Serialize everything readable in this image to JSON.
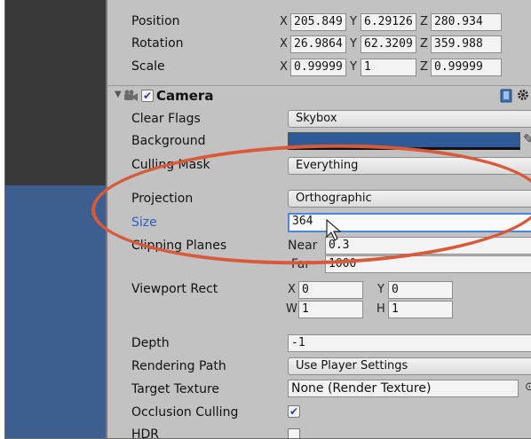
{
  "transform": {
    "position": {
      "label": "Position",
      "x_label": "X",
      "x": "205.849",
      "y_label": "Y",
      "y": "6.29126",
      "z_label": "Z",
      "z": "280.934"
    },
    "rotation": {
      "label": "Rotation",
      "x_label": "X",
      "x": "26.9864",
      "y_label": "Y",
      "y": "62.3209",
      "z_label": "Z",
      "z": "359.988"
    },
    "scale": {
      "label": "Scale",
      "x_label": "X",
      "x": "0.99999",
      "y_label": "Y",
      "y": "1",
      "z_label": "Z",
      "z": "0.99999"
    }
  },
  "camera": {
    "title": "Camera",
    "enabled_check": "✔",
    "clear_flags": {
      "label": "Clear Flags",
      "value": "Skybox"
    },
    "background": {
      "label": "Background",
      "color": "#2e5b96"
    },
    "culling_mask": {
      "label": "Culling Mask",
      "value": "Everything"
    },
    "projection": {
      "label": "Projection",
      "value": "Orthographic"
    },
    "size": {
      "label": "Size",
      "value": "364"
    },
    "clipping_planes": {
      "label": "Clipping Planes",
      "near_label": "Near",
      "near": "0.3",
      "far_label": "Far",
      "far": "1000"
    },
    "viewport_rect": {
      "label": "Viewport Rect",
      "x_label": "X",
      "x": "0",
      "y_label": "Y",
      "y": "0",
      "w_label": "W",
      "w": "1",
      "h_label": "H",
      "h": "1"
    },
    "depth": {
      "label": "Depth",
      "value": "-1"
    },
    "rendering_path": {
      "label": "Rendering Path",
      "value": "Use Player Settings"
    },
    "target_texture": {
      "label": "Target Texture",
      "value": "None (Render Texture)"
    },
    "occlusion_culling": {
      "label": "Occlusion Culling",
      "check": "✔"
    },
    "hdr": {
      "label": "HDR"
    }
  },
  "colors": {
    "annotation": "#d85a3a",
    "focus": "#4d86e0",
    "selected_label": "#2a5fcf",
    "scene_blue": "#3d5f8f"
  }
}
